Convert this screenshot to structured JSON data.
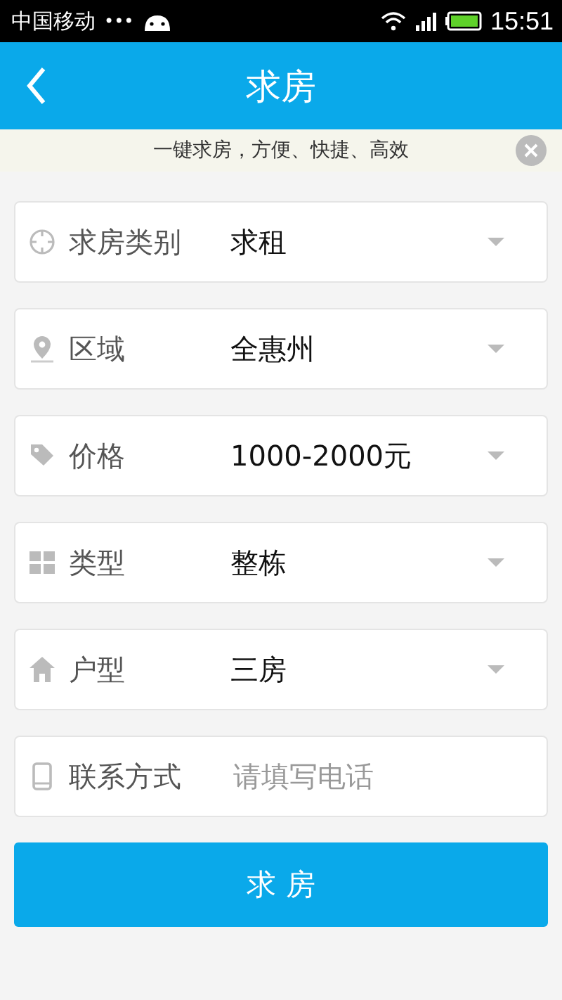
{
  "status_bar": {
    "carrier": "中国移动",
    "dots": "•••",
    "time": "15:51"
  },
  "header": {
    "title": "求房"
  },
  "banner": {
    "text": "一键求房，方便、快捷、高效"
  },
  "fields": [
    {
      "kind": "select",
      "label": "求房类别",
      "value": "求租"
    },
    {
      "kind": "select",
      "label": "区域",
      "value": "全惠州"
    },
    {
      "kind": "select",
      "label": "价格",
      "value": "1000-2000元"
    },
    {
      "kind": "select",
      "label": "类型",
      "value": "整栋"
    },
    {
      "kind": "select",
      "label": "户型",
      "value": "三房"
    },
    {
      "kind": "input",
      "label": "联系方式",
      "placeholder": "请填写电话"
    }
  ],
  "submit": "求 房"
}
